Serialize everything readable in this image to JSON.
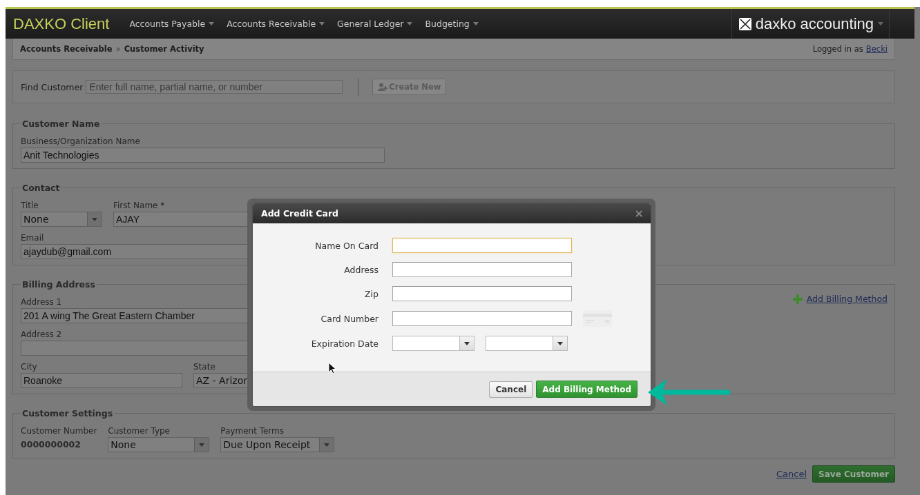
{
  "nav": {
    "brand": "DAXKO Client",
    "menus": [
      {
        "label": "Accounts Payable"
      },
      {
        "label": "Accounts Receivable"
      },
      {
        "label": "General Ledger"
      },
      {
        "label": "Budgeting"
      }
    ],
    "product": "daxko accounting"
  },
  "breadcrumb": {
    "items": [
      "Accounts Receivable",
      "Customer Activity"
    ],
    "separator": "»"
  },
  "user": {
    "prefix": "Logged in as",
    "name": "Becki"
  },
  "find": {
    "label": "Find Customer",
    "placeholder": "Enter full name, partial name, or number",
    "button": "Create New"
  },
  "sections": [
    {
      "legend": "Customer Name",
      "rows": [
        [
          {
            "kind": "text",
            "label": "Business/Organization Name",
            "value": "Anit Technologies"
          }
        ]
      ]
    },
    {
      "legend": "Contact",
      "rows": [
        [
          {
            "kind": "select",
            "label": "Title",
            "value": "None"
          },
          {
            "kind": "text",
            "label": "First Name *",
            "value": "AJAY"
          }
        ],
        [
          {
            "kind": "text",
            "label": "Email",
            "value": "ajaydub@gmail.com"
          }
        ]
      ]
    },
    {
      "legend": "Billing Address",
      "link": "Add Billing Method",
      "rows": [
        [
          {
            "kind": "text",
            "label": "Address 1",
            "value": "201 A wing The Great Eastern Chamber"
          }
        ],
        [
          {
            "kind": "text",
            "label": "Address 2"
          }
        ],
        [
          {
            "kind": "text",
            "label": "City",
            "value": "Roanoke"
          },
          {
            "kind": "select",
            "label": "State",
            "value": "AZ - Arizon"
          }
        ]
      ]
    },
    {
      "legend": "Customer Settings",
      "rows": [
        [
          {
            "kind": "static",
            "label": "Customer Number",
            "value": "0000000002"
          },
          {
            "kind": "select",
            "label": "Customer Type",
            "value": "None"
          },
          {
            "kind": "select",
            "label": "Payment Terms",
            "value": "Due Upon Receipt"
          }
        ]
      ]
    }
  ],
  "footer": {
    "cancel": "Cancel",
    "save": "Save Customer"
  },
  "modal": {
    "title": "Add Credit Card",
    "close": "×",
    "fields": [
      {
        "kind": "text",
        "label": "Name On Card",
        "focused": true
      },
      {
        "kind": "text",
        "label": "Address",
        "focused": false
      },
      {
        "kind": "text",
        "label": "Zip",
        "focused": false
      },
      {
        "kind": "card",
        "label": "Card Number",
        "focused": false
      },
      {
        "kind": "date",
        "label": "Expiration Date",
        "focused": false
      }
    ],
    "cancel": "Cancel",
    "submit": "Add Billing Method"
  }
}
